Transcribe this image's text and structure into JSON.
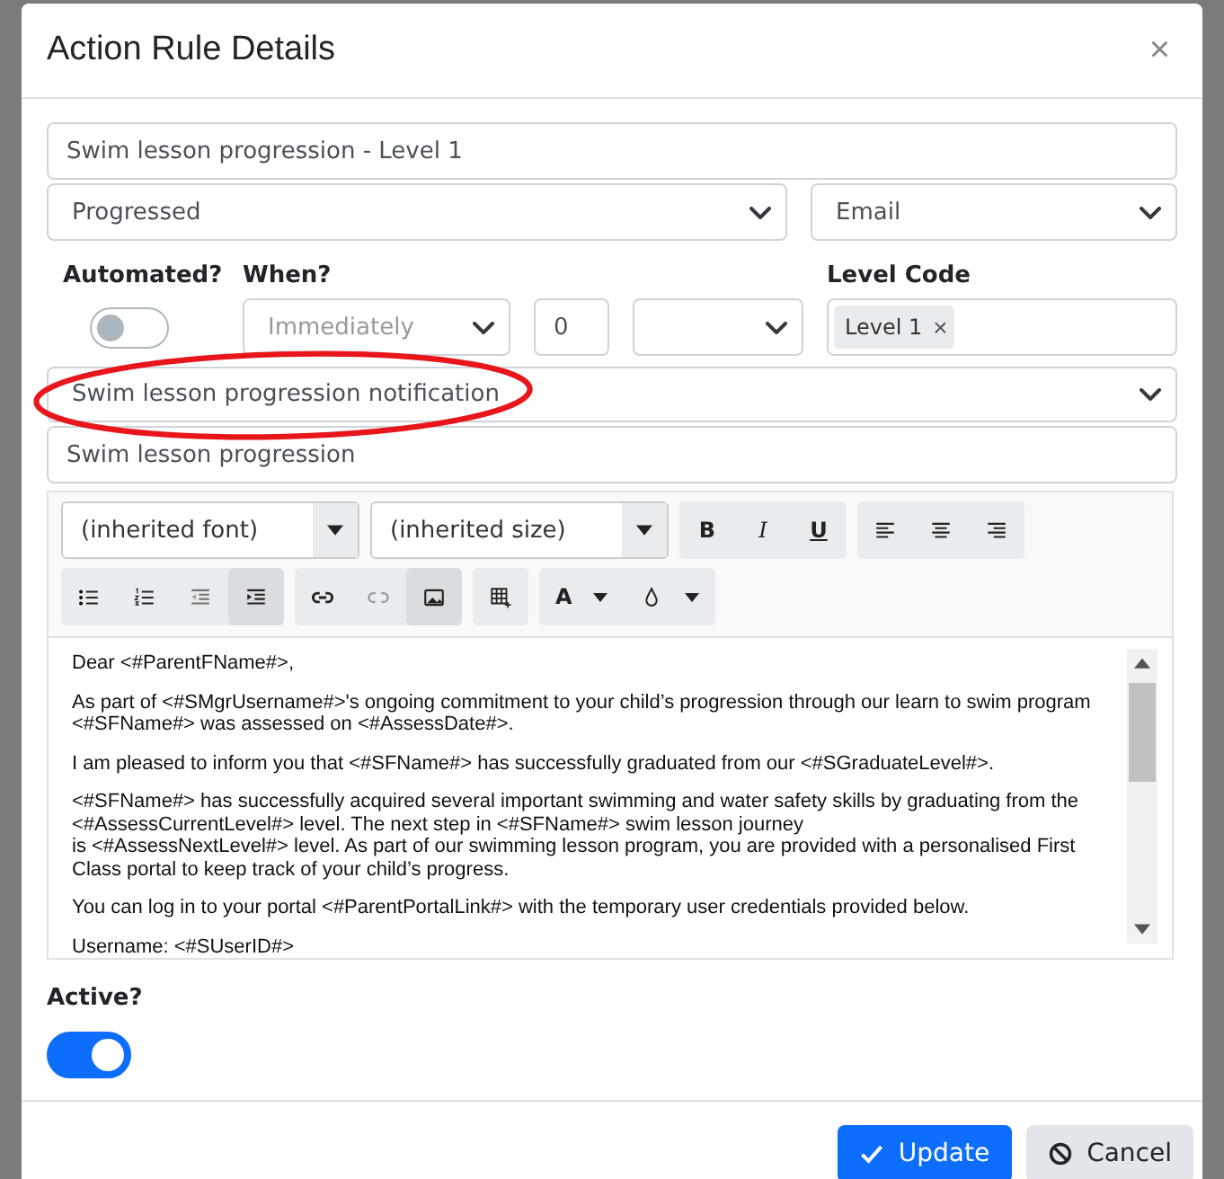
{
  "dialog": {
    "title": "Action Rule Details",
    "close": "×"
  },
  "name_field": {
    "value": "Swim lesson progression - Level 1"
  },
  "trigger_select": {
    "value": "Progressed"
  },
  "channel_select": {
    "value": "Email"
  },
  "automated": {
    "label": "Automated?",
    "on": false
  },
  "when": {
    "label": "When?",
    "value": "Immediately",
    "disabled": true
  },
  "delay_amount": {
    "value": "0"
  },
  "level_code": {
    "label": "Level Code",
    "tags": [
      {
        "text": "Level 1",
        "remove": "×"
      }
    ]
  },
  "template_select": {
    "value": "Swim lesson progression notification",
    "annotation": {
      "kind": "ellipse"
    }
  },
  "subject_field": {
    "value": "Swim lesson progression"
  },
  "editor": {
    "font_select": "(inherited font)",
    "size_select": "(inherited size)",
    "format_buttons": [
      "B",
      "I",
      "U"
    ],
    "color_button": "A",
    "body": [
      [
        "Dear <#ParentFName#>,"
      ],
      [
        "As part of <#SMgrUsername#>'s ongoing commitment to your child’s progression through our learn to swim program <#SFName#> was assessed on <#AssessDate#>."
      ],
      [
        "I am pleased to inform you that <#SFName#> has successfully graduated from our <#SGraduateLevel#>."
      ],
      [
        "<#SFName#> has successfully acquired several important swimming and water safety skills by graduating from the <#AssessCurrentLevel#> level. The next step in <#SFName#> swim lesson journey",
        "is <#AssessNextLevel#> level. As part of our swimming lesson program, you are provided with a personalised First Class portal to keep track of your child’s progress."
      ],
      [
        "You can log in to your portal <#ParentPortalLink#> with the temporary user credentials provided below."
      ],
      [
        "Username: <#SUserID#>"
      ]
    ]
  },
  "active": {
    "label": "Active?",
    "on": true
  },
  "buttons": [
    {
      "kind": "primary",
      "label": "Update"
    },
    {
      "kind": "secondary",
      "label": "Cancel"
    }
  ]
}
